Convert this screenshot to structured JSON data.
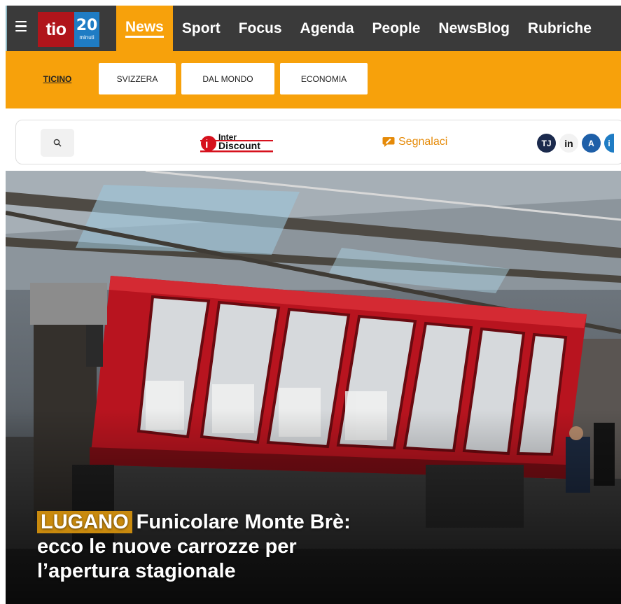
{
  "header": {
    "logo_text": "tio",
    "logo_20": "20",
    "logo_minuti": "minuti",
    "nav": [
      {
        "label": "News",
        "active": true
      },
      {
        "label": "Sport"
      },
      {
        "label": "Focus"
      },
      {
        "label": "Agenda"
      },
      {
        "label": "People"
      },
      {
        "label": "NewsBlog"
      },
      {
        "label": "Rubriche"
      }
    ]
  },
  "subnav": {
    "tabs": [
      {
        "label": "TICINO",
        "active": true
      },
      {
        "label": "SVIZZERA"
      },
      {
        "label": "DAL MONDO"
      },
      {
        "label": "ECONOMIA"
      }
    ]
  },
  "tools": {
    "search_icon": "search-icon",
    "sponsor_line1": "Inter",
    "sponsor_line2": "Discount",
    "report_label": "Segnalaci",
    "partners": [
      "TJ",
      "in",
      "A",
      "i"
    ]
  },
  "hero": {
    "tag": "LUGANO",
    "title_line1": "Funicolare Monte Brè:",
    "title_line2": "ecco le nuove carrozze per",
    "title_line3": "l’apertura stagionale"
  },
  "colors": {
    "nav_bg": "#3a3a3a",
    "accent": "#f7a10b",
    "tio_red": "#b0151b",
    "blue_20": "#1f7cc4",
    "tag_bg": "#c98a0e"
  }
}
